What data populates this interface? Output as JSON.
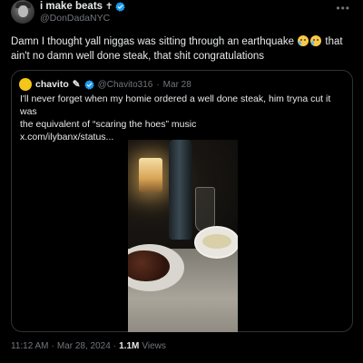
{
  "author": {
    "display_name": "i make beats",
    "name_symbol": "✝",
    "handle": "@DonDadaNYC",
    "verified": true,
    "more_icon": "more-dots-icon"
  },
  "tweet": {
    "text_before_emoji": "Damn I thought yall niggas was sitting through an earthquake",
    "emojis": [
      "crying-face",
      "crying-face"
    ],
    "text_after_emoji": " that ain't no damn well done steak, that shit congratulations"
  },
  "quote": {
    "display_name": "chavito",
    "name_symbol": "✎",
    "handle": "@Chavito316",
    "separator": "·",
    "date": "Mar 28",
    "verified": true,
    "text_line1": "I'll never forget when my homie ordered a well done steak, him tryna cut it was",
    "text_line2": "the equivalent of “scaring the hoes” music",
    "link": "x.com/ilybanx/status..."
  },
  "meta": {
    "time": "11:12 AM",
    "separator": "·",
    "date": "Mar 28, 2024",
    "separator2": "·",
    "views_count": "1.1M",
    "views_label": "Views"
  },
  "colors": {
    "background": "#000000",
    "text": "#e7e9ea",
    "secondary": "#71767b",
    "verified": "#1d9bf0",
    "border": "#2f3336"
  }
}
